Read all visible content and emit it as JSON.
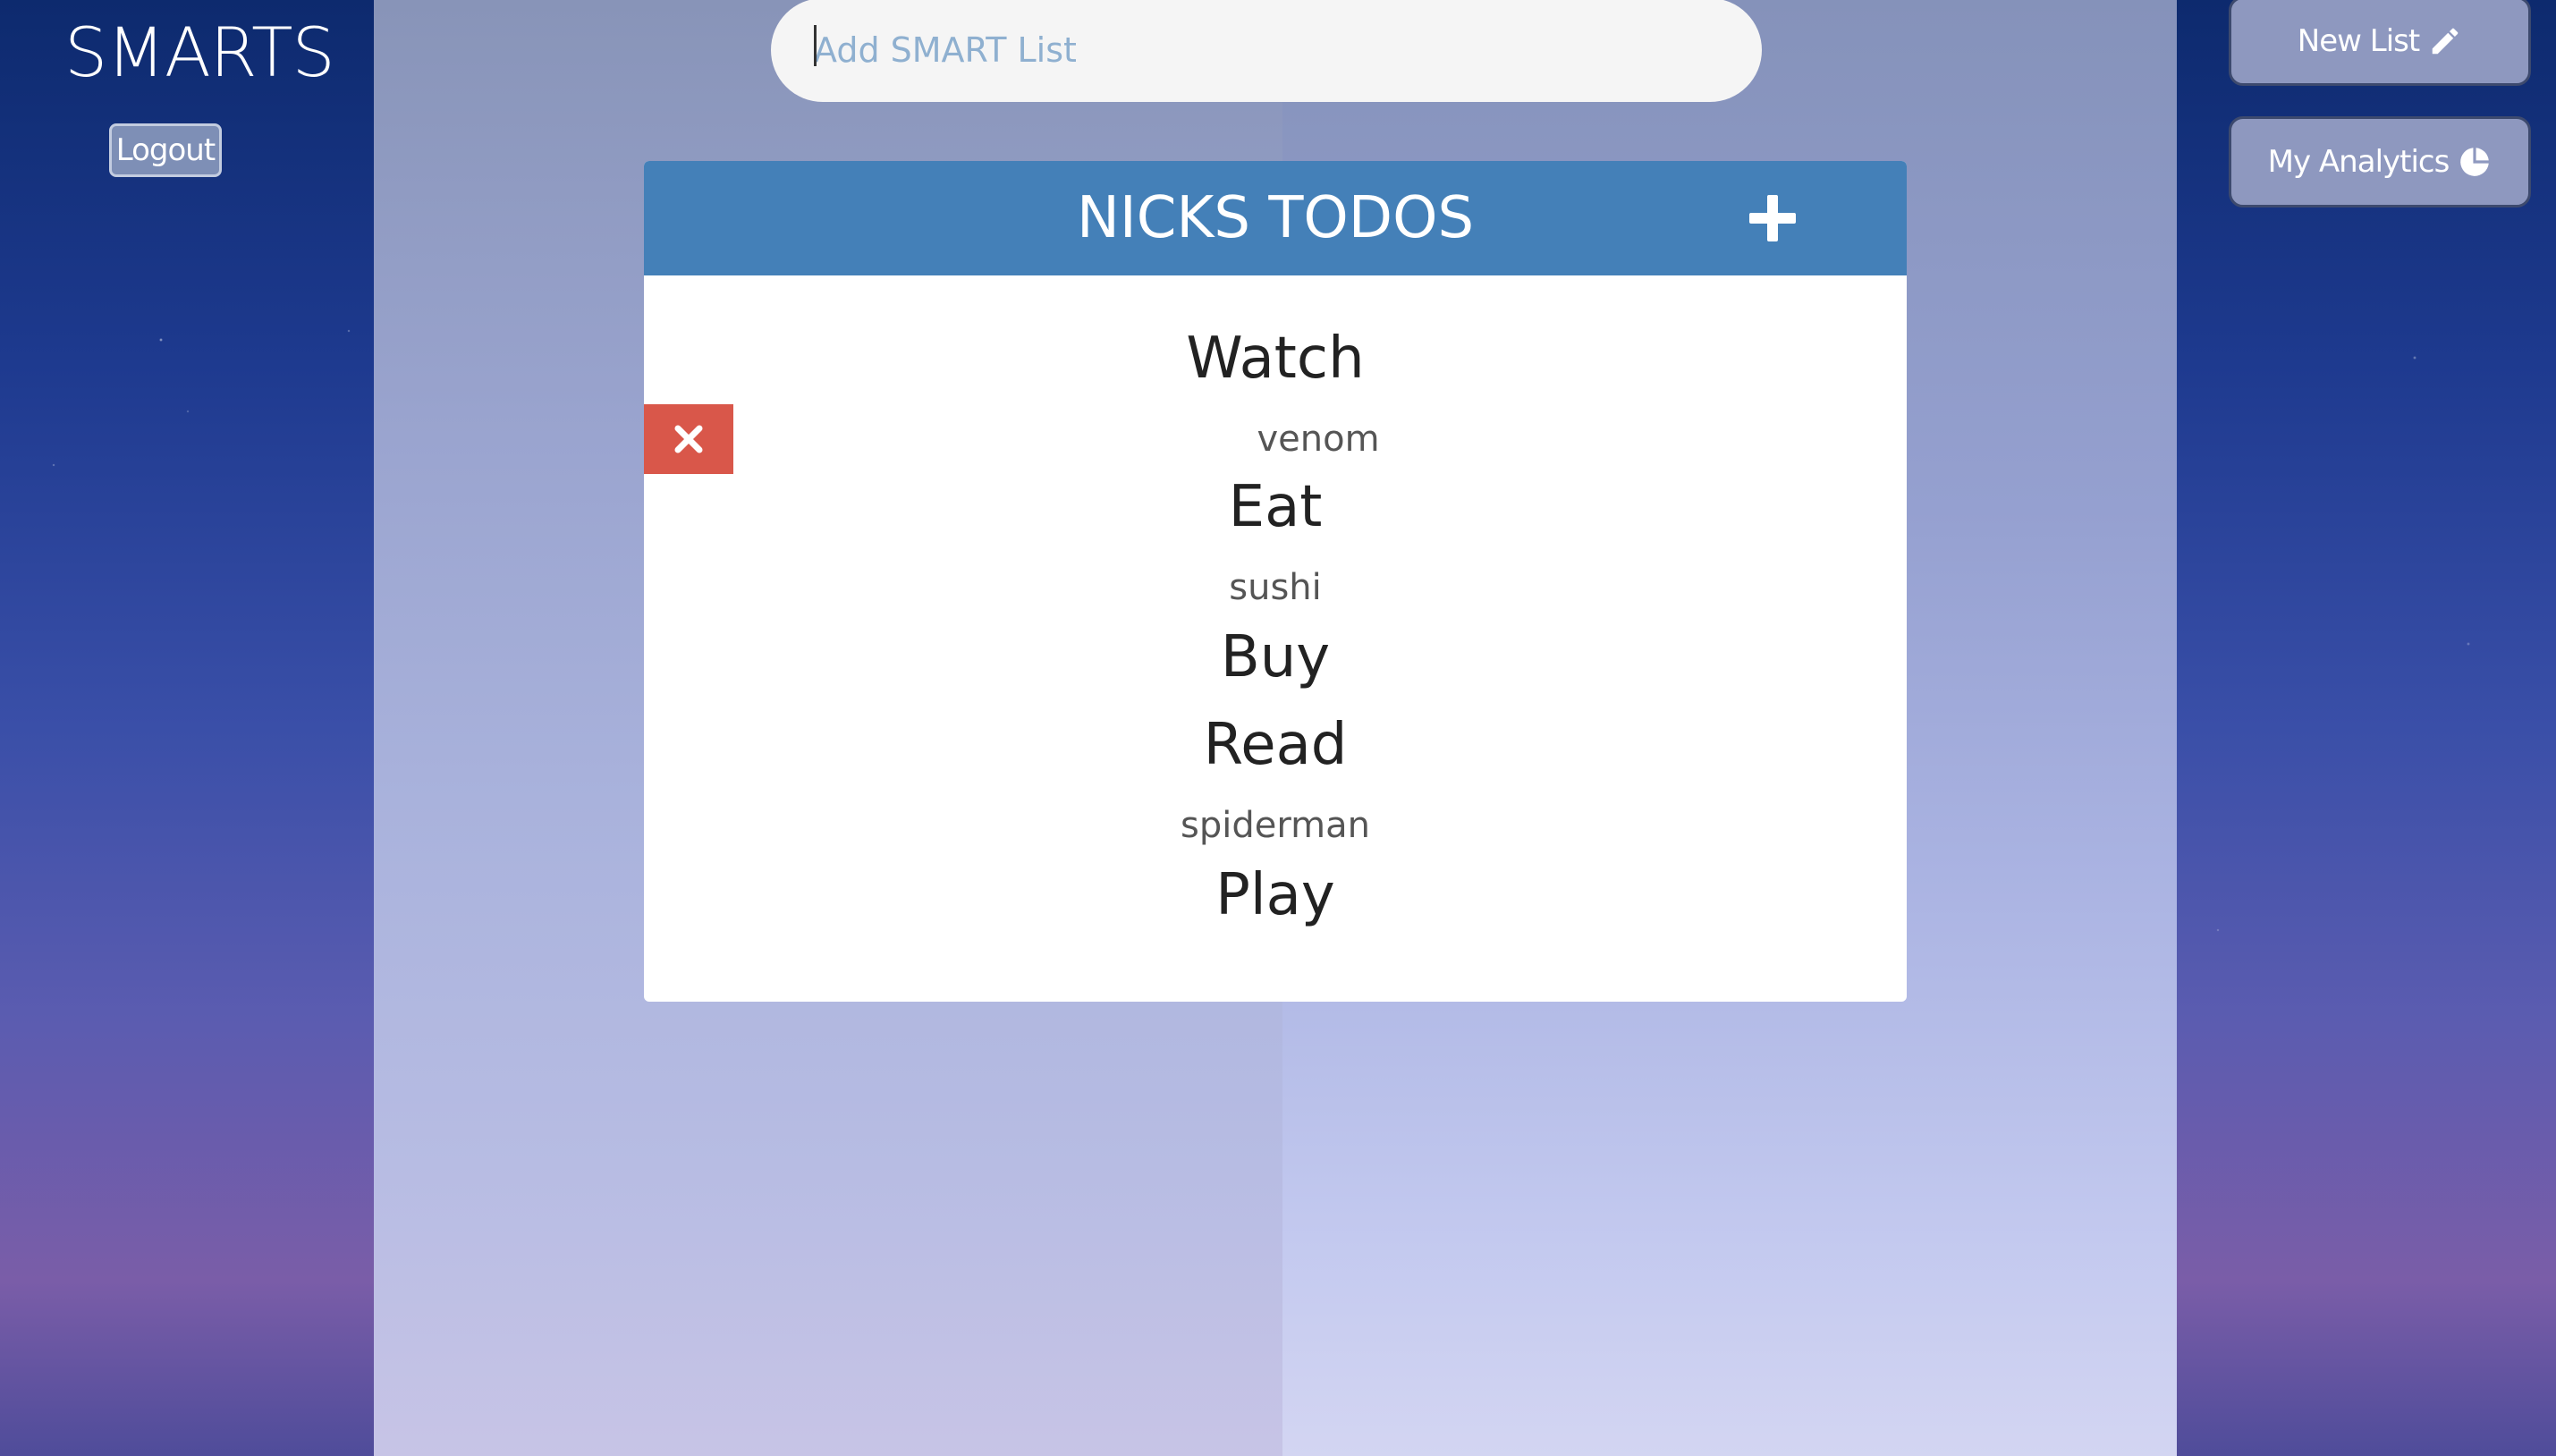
{
  "app": {
    "brand": "SMARTS",
    "logout_label": "Logout"
  },
  "search": {
    "placeholder": "Add SMART List"
  },
  "actions": {
    "new_list_label": "New List",
    "analytics_label": "My Analytics"
  },
  "list": {
    "title": "NICKS TODOS",
    "items": [
      {
        "category": "Watch",
        "detail": "venom"
      },
      {
        "category": "Eat",
        "detail": "sushi"
      },
      {
        "category": "Buy",
        "detail": ""
      },
      {
        "category": "Read",
        "detail": "spiderman"
      },
      {
        "category": "Play",
        "detail": ""
      }
    ]
  },
  "icons": {
    "new_list": "pencil-icon",
    "analytics": "pie-chart-icon",
    "add_item": "plus-icon",
    "delete_item": "close-icon"
  },
  "colors": {
    "header_blue": "#4480b8",
    "delete_red": "#d9574a"
  }
}
